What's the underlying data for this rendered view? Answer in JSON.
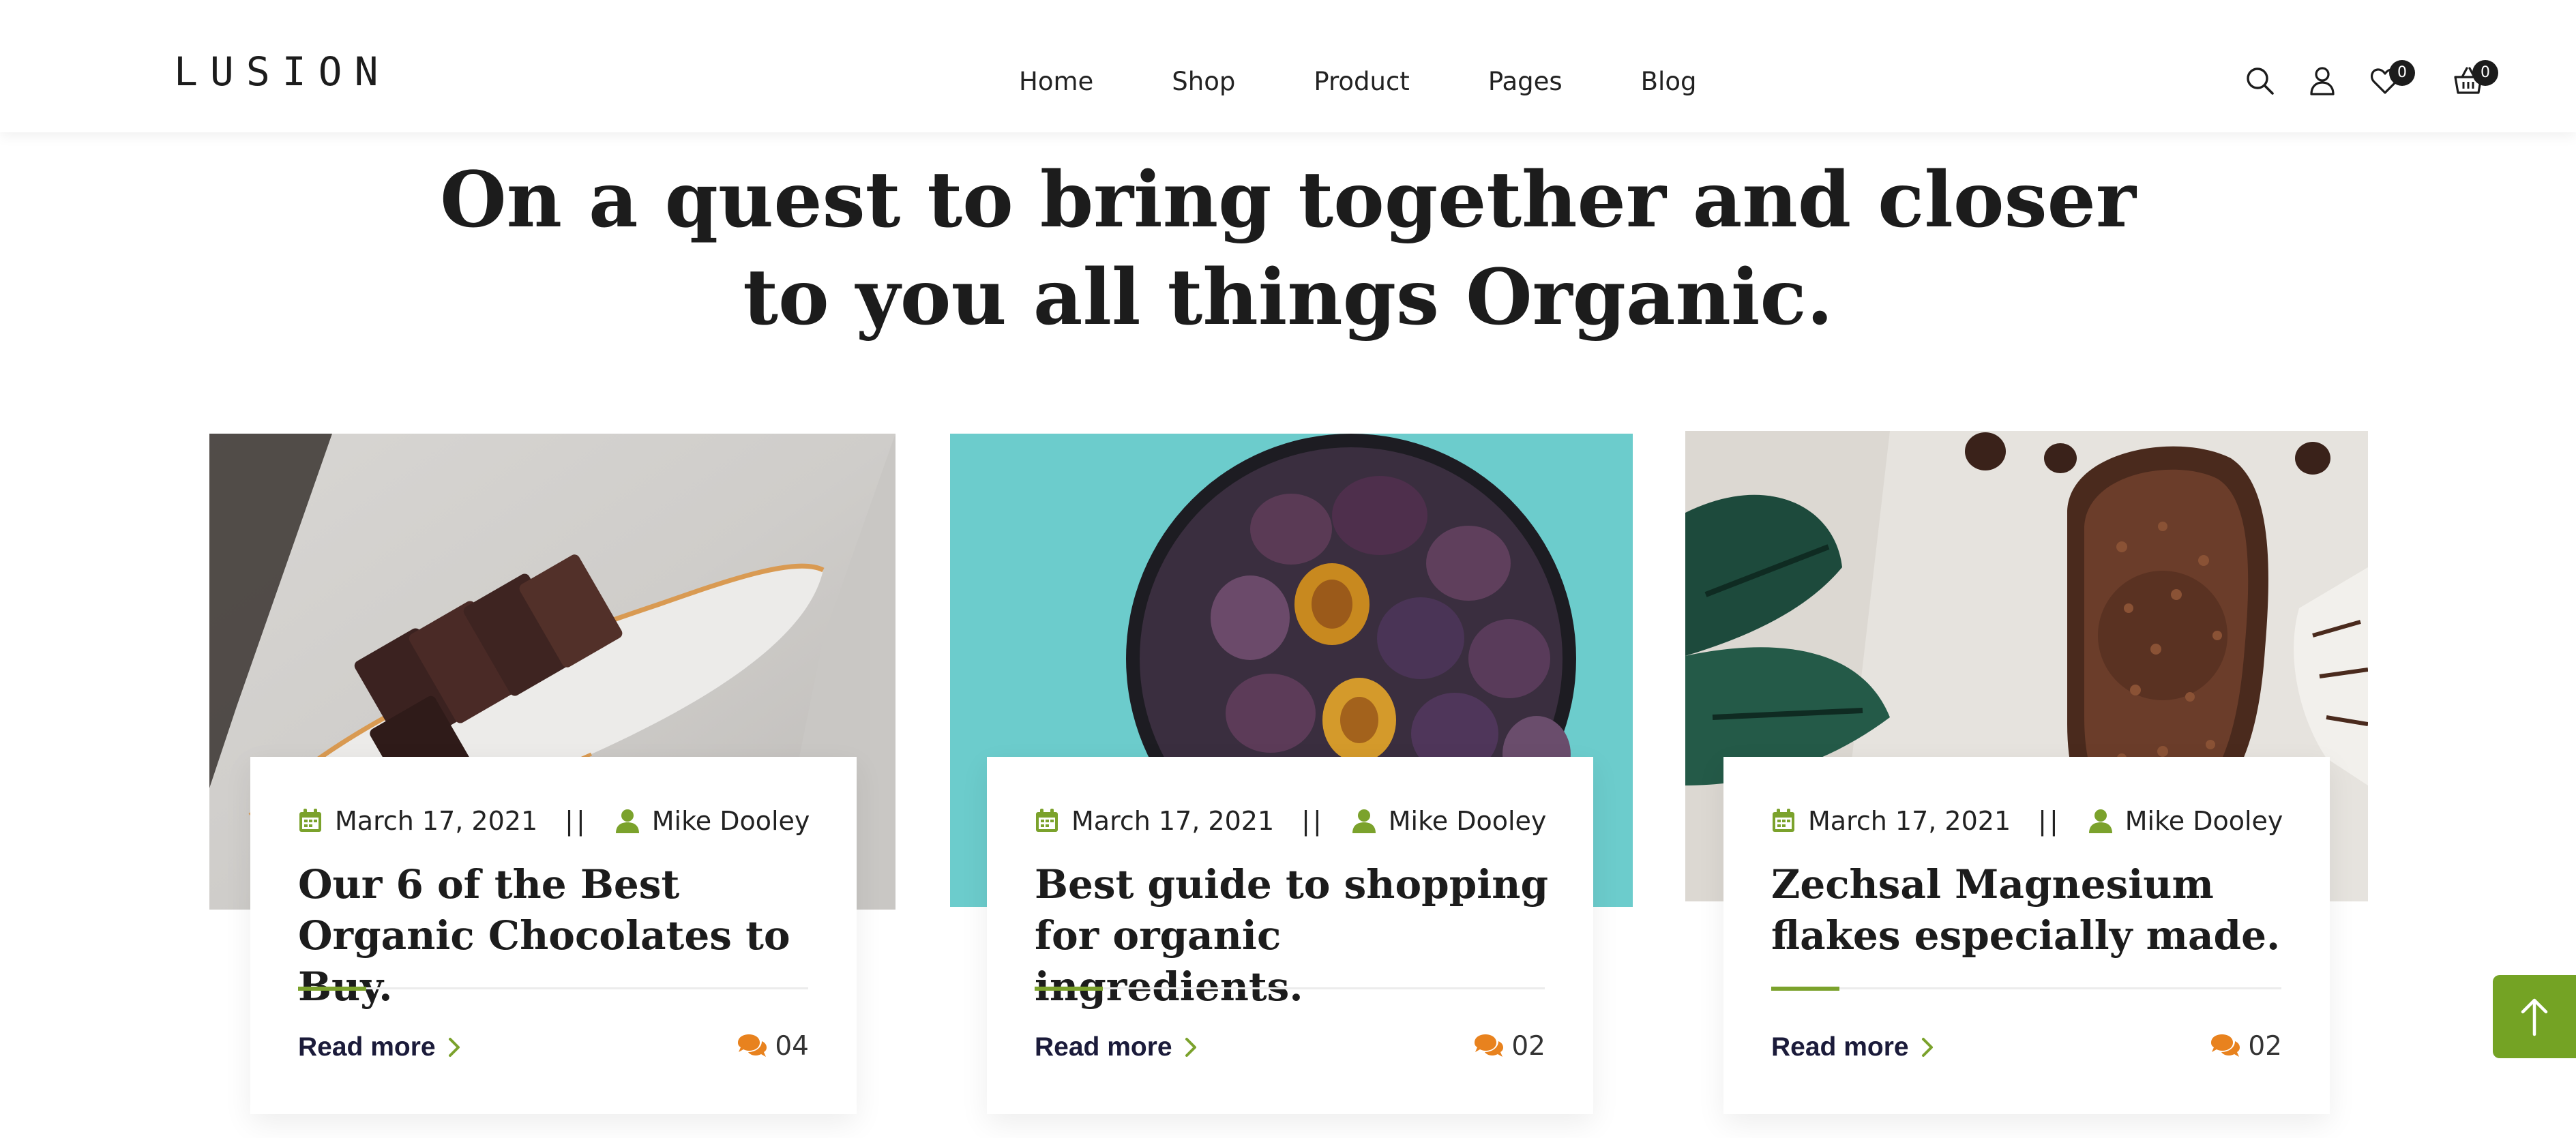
{
  "brand": {
    "logo_text": "LUSION"
  },
  "nav": {
    "items": [
      {
        "label": "Home"
      },
      {
        "label": "Shop"
      },
      {
        "label": "Product"
      },
      {
        "label": "Pages"
      },
      {
        "label": "Blog"
      }
    ]
  },
  "header_icons": {
    "search": "search-icon",
    "account": "user-icon",
    "wishlist": {
      "icon": "heart-icon",
      "count": "0"
    },
    "cart": {
      "icon": "basket-icon",
      "count": "0"
    }
  },
  "headline": {
    "line1": "On a quest to bring together and closer",
    "line2": "to you all things Organic."
  },
  "colors": {
    "accent_green": "#7ba22c",
    "comment_orange": "#e8821e",
    "title_dark": "#1b1b3a"
  },
  "posts": [
    {
      "date": "March 17, 2021",
      "separator": "||",
      "author": "Mike Dooley",
      "title": "Our 6 of the Best Organic Chocolates to Buy.",
      "read_more": "Read more",
      "comments": "04",
      "image": "chocolate-pieces-photo"
    },
    {
      "date": "March 17, 2021",
      "separator": "||",
      "author": "Mike Dooley",
      "title": "Best guide to shopping for organic ingredients.",
      "read_more": "Read more",
      "comments": "02",
      "image": "plums-bowl-photo"
    },
    {
      "date": "March 17, 2021",
      "separator": "||",
      "author": "Mike Dooley",
      "title": "Zechsal Magnesium flakes especially made.",
      "read_more": "Read more",
      "comments": "02",
      "image": "chocolate-sprinkles-spoon-photo"
    }
  ],
  "back_to_top": {
    "icon": "arrow-up-icon"
  }
}
